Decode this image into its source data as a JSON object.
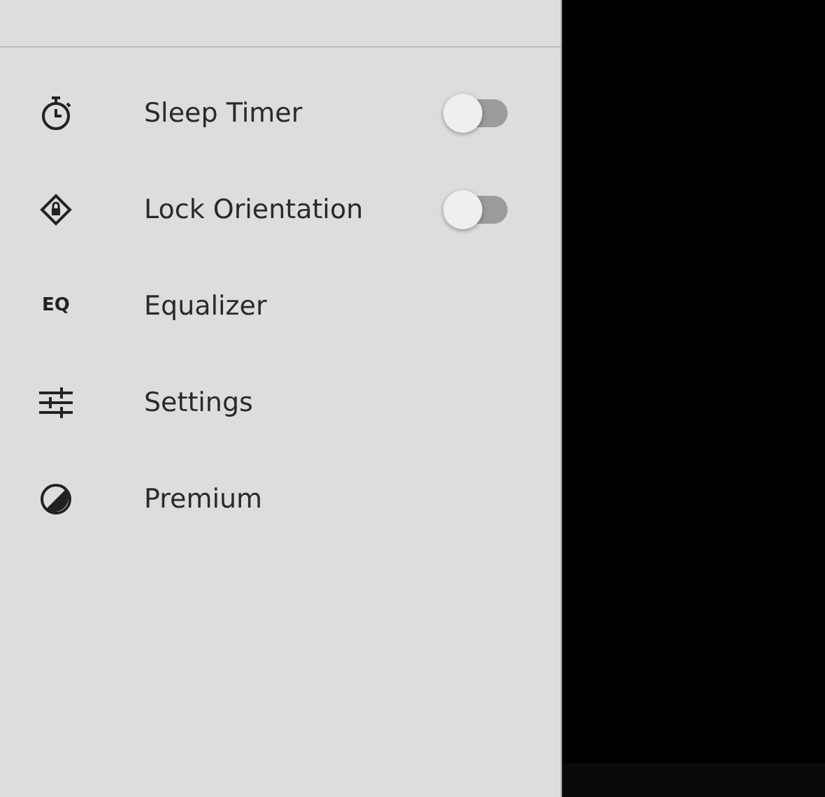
{
  "menu": [
    {
      "kind": "toggle",
      "label": "Sleep Timer",
      "on": false
    },
    {
      "kind": "toggle",
      "label": "Lock Orientation",
      "on": false
    },
    {
      "kind": "link",
      "icon_text": "EQ",
      "label": "Equalizer"
    },
    {
      "kind": "link",
      "label": "Settings"
    },
    {
      "kind": "link",
      "label": "Premium"
    }
  ]
}
